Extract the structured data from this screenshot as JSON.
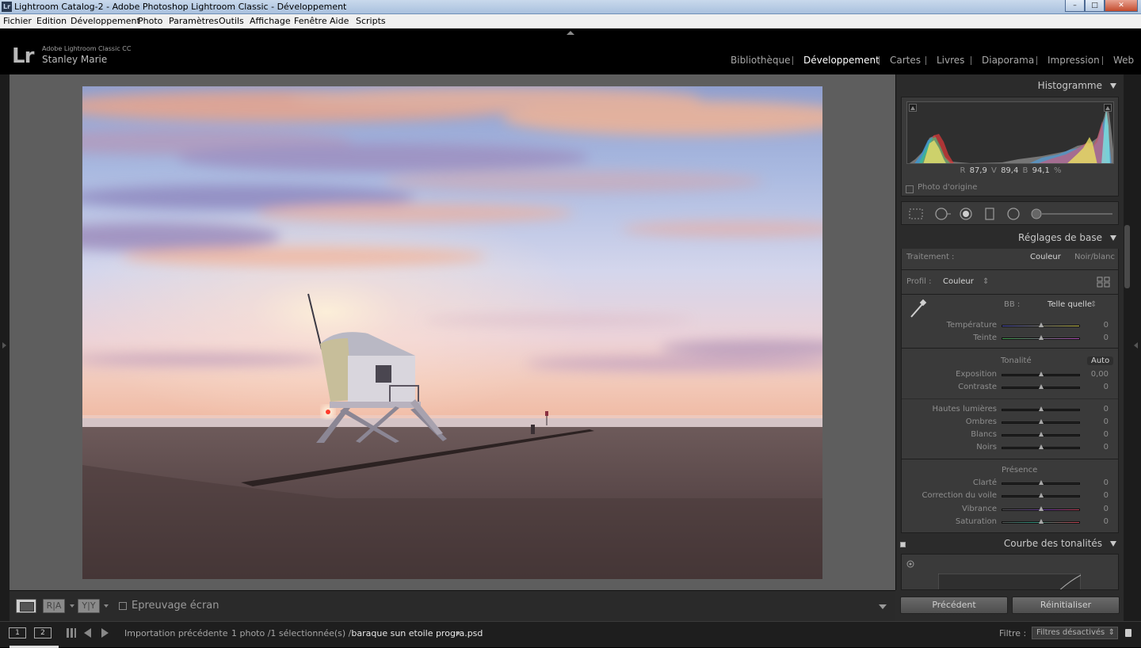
{
  "window": {
    "app_icon": "Lr",
    "title": "Lightroom Catalog-2 - Adobe Photoshop Lightroom Classic - Développement",
    "controls": [
      "minimize-icon",
      "maximize-icon",
      "close-icon"
    ]
  },
  "menu": [
    "Fichier",
    "Edition",
    "Développement",
    "Photo",
    "Paramètres",
    "Outils",
    "Affichage",
    "Fenêtre",
    "Aide",
    "Scripts"
  ],
  "identity": {
    "logo": "Lr",
    "app_name": "Adobe Lightroom Classic CC",
    "user_name": "Stanley Marie"
  },
  "modules": {
    "items": [
      "Bibliothèque",
      "Développement",
      "Cartes",
      "Livres",
      "Diaporama",
      "Impression",
      "Web"
    ],
    "active": "Développement"
  },
  "toolbar": {
    "ra_label": "R|A",
    "yy_label": "Y|Y",
    "softproof_label": "Epreuvage écran"
  },
  "histogram": {
    "title": "Histogramme",
    "r_label": "R",
    "r_value": "87,9",
    "v_label": "V",
    "v_value": "89,4",
    "b_label": "B",
    "b_value": "94,1",
    "unit": "%",
    "original_photo_label": "Photo d'origine"
  },
  "tools": [
    "crop-overlay-icon",
    "spot-removal-icon",
    "red-eye-icon",
    "graduated-filter-icon",
    "radial-filter-icon",
    "adjustment-brush-icon"
  ],
  "basic": {
    "title": "Réglages de base",
    "treatment_label": "Traitement :",
    "treatment_color": "Couleur",
    "treatment_bw": "Noir/blanc",
    "profile_label": "Profil :",
    "profile_value": "Couleur",
    "wb_label": "BB :",
    "wb_value": "Telle quelle",
    "temp_label": "Température",
    "temp_value": "0",
    "tint_label": "Teinte",
    "tint_value": "0",
    "tone_label": "Tonalité",
    "auto_label": "Auto",
    "exposure_label": "Exposition",
    "exposure_value": "0,00",
    "contrast_label": "Contraste",
    "contrast_value": "0",
    "highlights_label": "Hautes lumières",
    "highlights_value": "0",
    "shadows_label": "Ombres",
    "shadows_value": "0",
    "whites_label": "Blancs",
    "whites_value": "0",
    "blacks_label": "Noirs",
    "blacks_value": "0",
    "presence_label": "Présence",
    "clarity_label": "Clarté",
    "clarity_value": "0",
    "dehaze_label": "Correction du voile",
    "dehaze_value": "0",
    "vibrance_label": "Vibrance",
    "vibrance_value": "0",
    "saturation_label": "Saturation",
    "saturation_value": "0"
  },
  "tone_curve": {
    "title": "Courbe des tonalités"
  },
  "buttons": {
    "previous": "Précédent",
    "reset": "Réinitialiser"
  },
  "filmstrip": {
    "screen1": "1",
    "screen2": "2",
    "source": "Importation précédente",
    "count": "1 photo /1 sélectionnée(s) /",
    "filename": "baraque sun etoile progra.psd",
    "filter_label": "Filtre :",
    "filter_value": "Filtres désactivés"
  },
  "colors": {
    "accent_active": "#ffffff",
    "panel_bg": "#3a3a3a",
    "canvas_bg": "#5e5e5e"
  }
}
